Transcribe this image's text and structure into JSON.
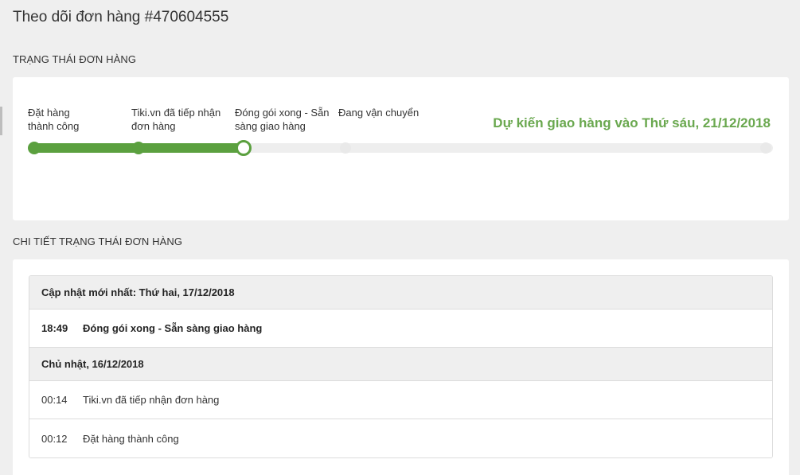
{
  "page": {
    "title": "Theo dõi đơn hàng #470604555"
  },
  "status_section": {
    "heading": "TRẠNG THÁI ĐƠN HÀNG",
    "steps": [
      {
        "label_line1": "Đặt hàng",
        "label_line2": "thành công",
        "state": "done"
      },
      {
        "label_line1": "Tiki.vn đã tiếp nhận",
        "label_line2": "đơn hàng",
        "state": "done"
      },
      {
        "label_line1": "Đóng gói xong - Sẵn",
        "label_line2": "sàng giao hàng",
        "state": "current"
      },
      {
        "label_line1": "",
        "label_line2": "Đang vận chuyển",
        "state": "pending"
      }
    ],
    "eta": "Dự kiến giao hàng vào Thứ sáu, 21/12/2018",
    "colors": {
      "accent": "#5ba03f",
      "eta_text": "#6aa84f",
      "pending": "#eeeeee"
    }
  },
  "detail_section": {
    "heading": "CHI TIẾT TRẠNG THÁI ĐƠN HÀNG",
    "groups": [
      {
        "date_label": "Cập nhật mới nhất: Thứ hai, 17/12/2018",
        "events": [
          {
            "time": "18:49",
            "text": "Đóng gói xong - Sẵn sàng giao hàng"
          }
        ]
      },
      {
        "date_label": "Chủ nhật, 16/12/2018",
        "events": [
          {
            "time": "00:14",
            "text": "Tiki.vn đã tiếp nhận đơn hàng"
          },
          {
            "time": "00:12",
            "text": "Đặt hàng thành công"
          }
        ]
      }
    ]
  }
}
